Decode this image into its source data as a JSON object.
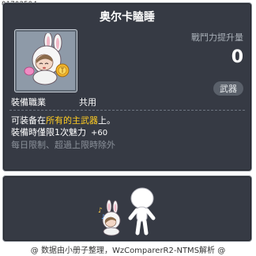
{
  "item_id": "01702594",
  "tooltip": {
    "title": "奥尔卡瞌睡",
    "power_label": "戰鬥力提升量",
    "power_value": "0",
    "category_badge": "武器",
    "job_label": "裝備職業",
    "job_value": "共用",
    "desc": {
      "line1_pre": "可装备在",
      "line1_highlight": "所有的主武器",
      "line1_post": "上。",
      "line2": "裝備時僅限1次魅力",
      "line2_bonus": "+60",
      "line3": "每日限制、超過上限時除外"
    }
  },
  "footer": "@ 数据由小册子整理，WzComparerR2-NTMS解析 @",
  "colors": {
    "panel_bg": "#363a44",
    "panel_border": "#8a9098",
    "highlight": "#ffcc22",
    "muted": "#8b919a"
  },
  "icons": {
    "item_icon": "bunny-hood-doll-with-coin",
    "preview": "character-preview-with-bunny-doll"
  }
}
